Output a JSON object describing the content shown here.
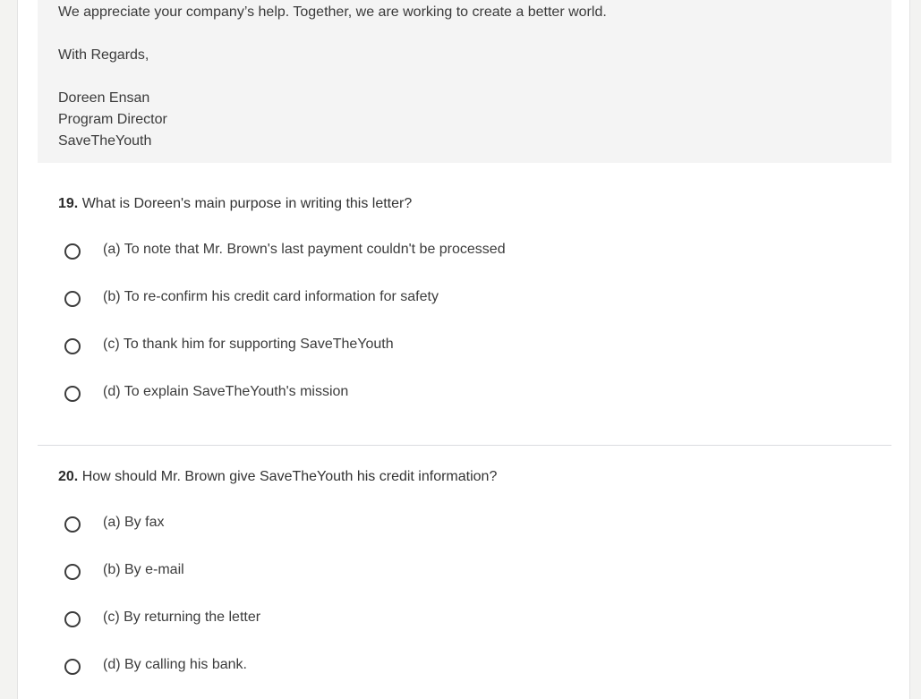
{
  "passage": {
    "lines": [
      "We appreciate your company’s help. Together, we are working to create a better world.",
      "With Regards,",
      "Doreen Ensan",
      "Program Director",
      "SaveTheYouth"
    ]
  },
  "questions": [
    {
      "number": "19.",
      "text": "What is Doreen's main purpose in writing this letter?",
      "options": [
        "(a) To note that Mr. Brown's last payment couldn't be processed",
        "(b) To re-confirm his credit card information for safety",
        "(c) To thank him for supporting SaveTheYouth",
        "(d) To explain SaveTheYouth's mission"
      ]
    },
    {
      "number": "20.",
      "text": "How should Mr. Brown give SaveTheYouth his credit information?",
      "options": [
        "(a) By fax",
        "(b) By e-mail",
        "(c) By returning the letter",
        "(d) By calling his bank."
      ]
    }
  ]
}
